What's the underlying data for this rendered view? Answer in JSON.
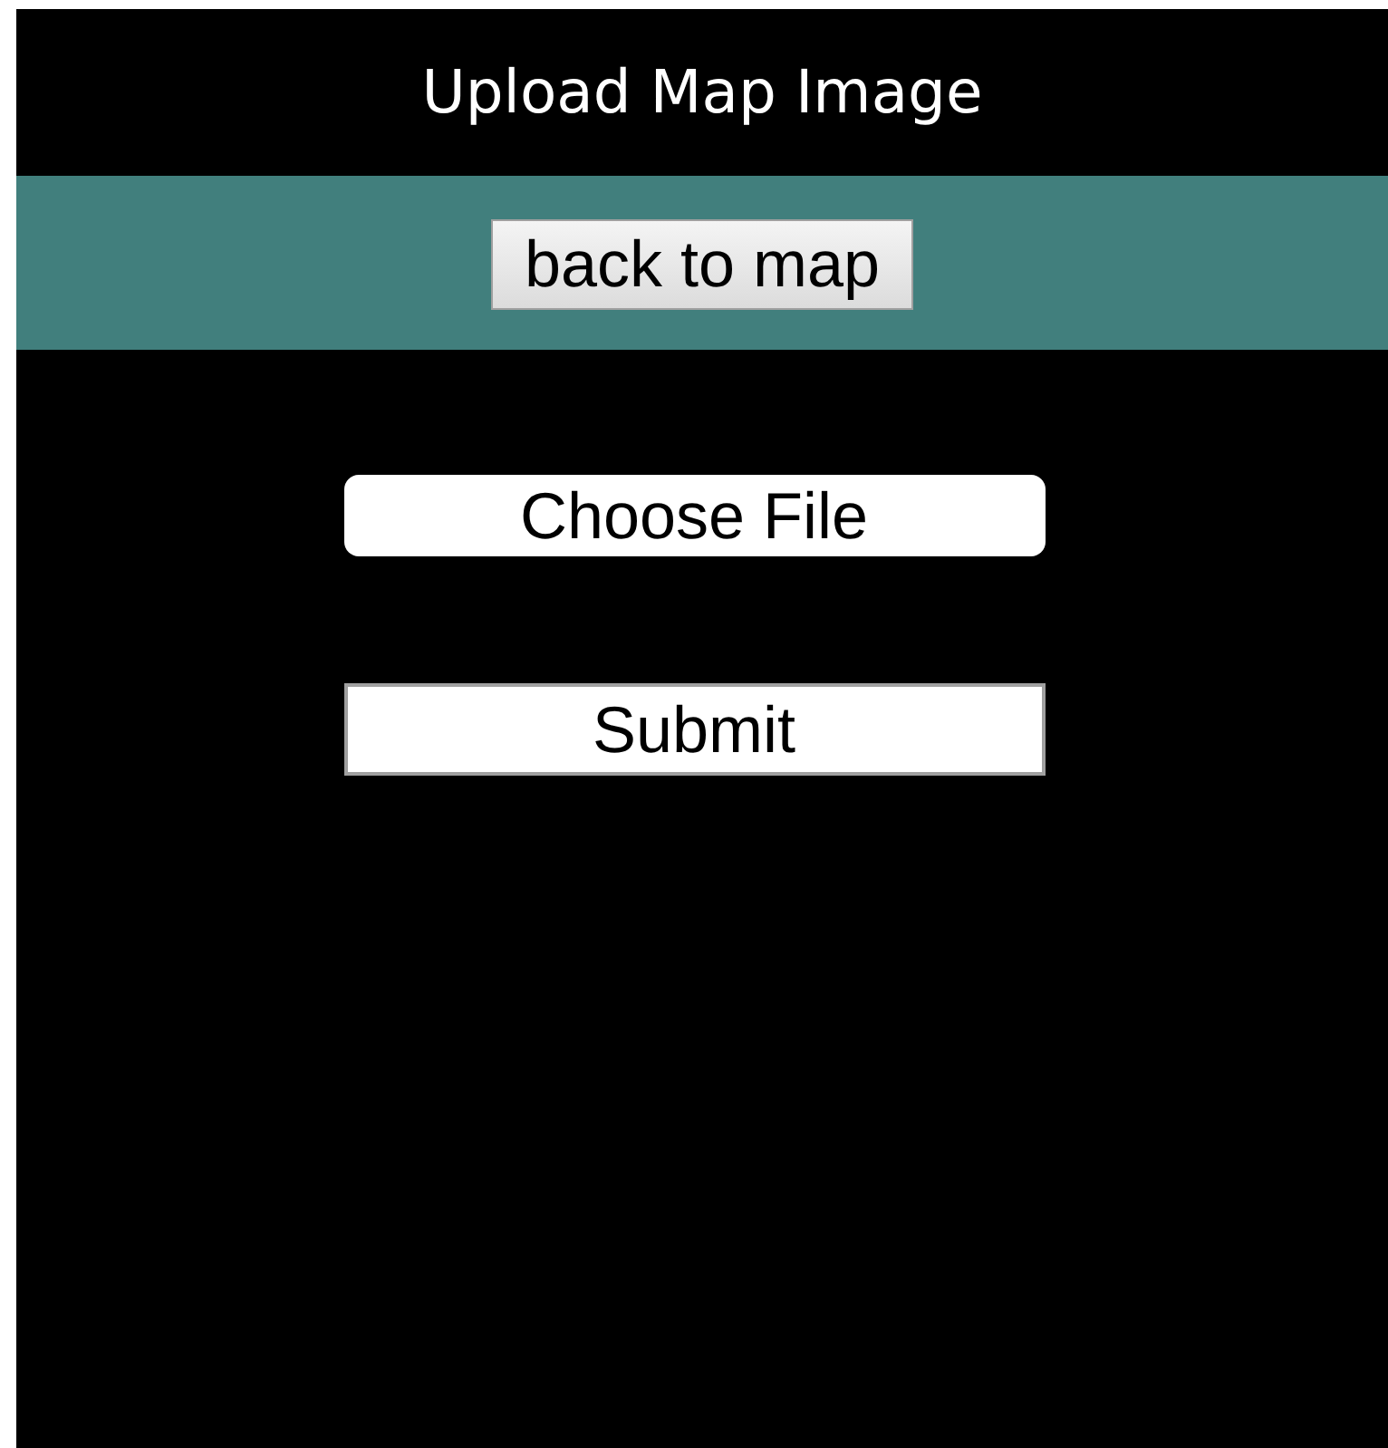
{
  "header": {
    "title": "Upload Map Image"
  },
  "nav": {
    "back_button": "back to map"
  },
  "form": {
    "file_button": "Choose File",
    "submit_button": "Submit"
  }
}
